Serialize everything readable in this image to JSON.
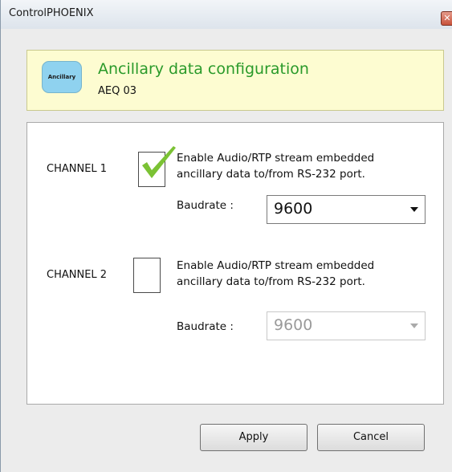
{
  "window": {
    "title": "ControlPHOENIX",
    "close_glyph": "✕"
  },
  "header": {
    "logo_text": "Ancillary",
    "title": "Ancillary data configuration",
    "subtitle": "AEQ 03"
  },
  "channels": [
    {
      "label": "CHANNEL 1",
      "enabled": true,
      "description_line1": "Enable Audio/RTP stream embedded",
      "description_line2": "ancillary data to/from RS-232 port.",
      "baudrate_label": "Baudrate :",
      "baudrate_value": "9600",
      "select_disabled": false
    },
    {
      "label": "CHANNEL 2",
      "enabled": false,
      "description_line1": "Enable Audio/RTP stream embedded",
      "description_line2": "ancillary data to/from RS-232 port.",
      "baudrate_label": "Baudrate :",
      "baudrate_value": "9600",
      "select_disabled": true
    }
  ],
  "buttons": {
    "apply": "Apply",
    "cancel": "Cancel"
  },
  "colors": {
    "header_background": "#fdfcd1",
    "header_title": "#2a9a2a",
    "logo_background": "#8fd2ef",
    "check_mark": "#7bc234"
  }
}
